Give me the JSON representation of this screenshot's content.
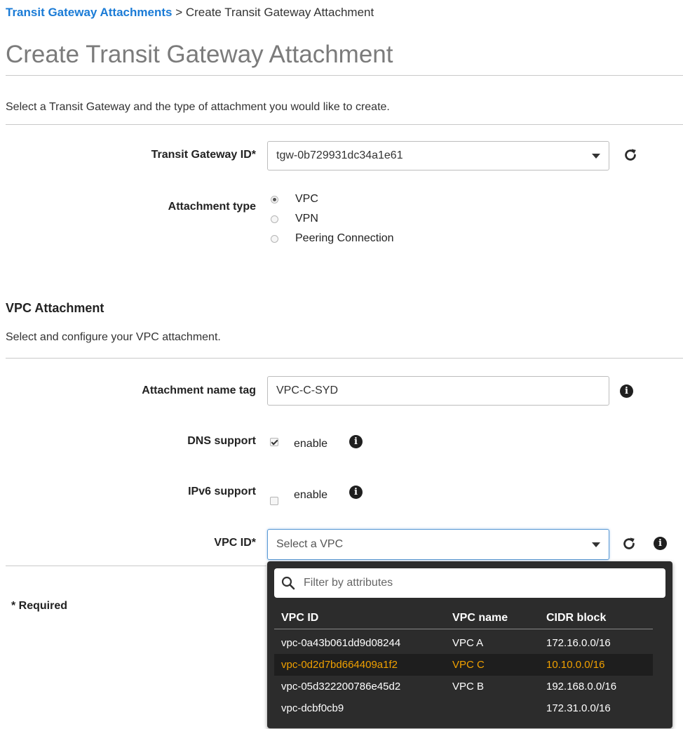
{
  "breadcrumb": {
    "link": "Transit Gateway Attachments",
    "separator": ">",
    "current": "Create Transit Gateway Attachment"
  },
  "page_title": "Create Transit Gateway Attachment",
  "intro_text": "Select a Transit Gateway and the type of attachment you would like to create.",
  "transit_gateway": {
    "label": "Transit Gateway ID*",
    "value": "tgw-0b729931dc34a1e61"
  },
  "attachment_type": {
    "label": "Attachment type",
    "options": [
      "VPC",
      "VPN",
      "Peering Connection"
    ],
    "selected": "VPC"
  },
  "vpc_attachment": {
    "heading": "VPC Attachment",
    "description": "Select and configure your VPC attachment.",
    "name_tag": {
      "label": "Attachment name tag",
      "value": "VPC-C-SYD"
    },
    "dns_support": {
      "label": "DNS support",
      "checkbox_label": "enable",
      "checked": true
    },
    "ipv6_support": {
      "label": "IPv6 support",
      "checkbox_label": "enable",
      "checked": false
    },
    "vpc_id": {
      "label": "VPC ID*",
      "placeholder": "Select a VPC"
    }
  },
  "required_note": "* Required",
  "dropdown": {
    "filter_placeholder": "Filter by attributes",
    "columns": [
      "VPC ID",
      "VPC name",
      "CIDR block"
    ],
    "rows": [
      {
        "id": "vpc-0a43b061dd9d08244",
        "name": "VPC A",
        "cidr": "172.16.0.0/16"
      },
      {
        "id": "vpc-0d2d7bd664409a1f2",
        "name": "VPC C",
        "cidr": "10.10.0.0/16"
      },
      {
        "id": "vpc-05d322200786e45d2",
        "name": "VPC B",
        "cidr": "192.168.0.0/16"
      },
      {
        "id": "vpc-dcbf0cb9",
        "name": "",
        "cidr": "172.31.0.0/16"
      }
    ],
    "highlighted_row": 1
  },
  "colors": {
    "link": "#1a7bd6",
    "highlight": "#f0a000",
    "dropdown_bg": "#2c2c2c"
  },
  "icons": [
    "refresh-icon",
    "info-icon",
    "search-icon",
    "caret-down-icon"
  ]
}
